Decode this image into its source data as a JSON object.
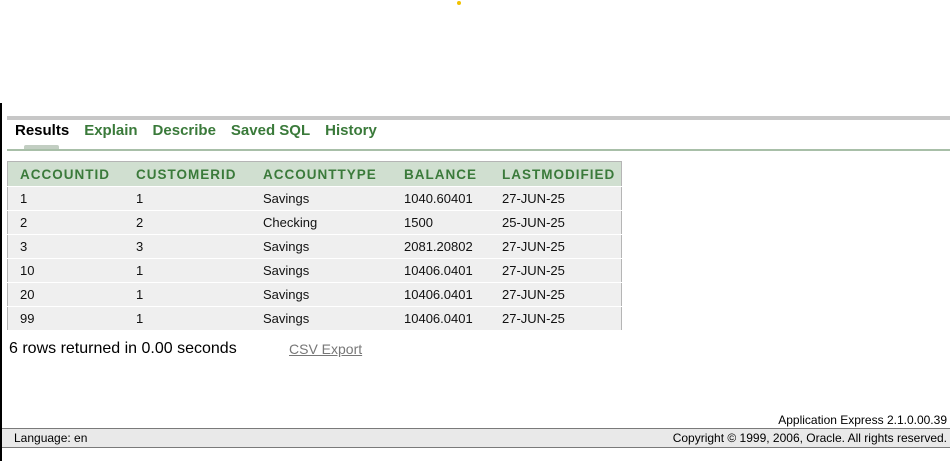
{
  "tabs": [
    {
      "label": "Results",
      "active": true
    },
    {
      "label": "Explain",
      "active": false
    },
    {
      "label": "Describe",
      "active": false
    },
    {
      "label": "Saved SQL",
      "active": false
    },
    {
      "label": "History",
      "active": false
    }
  ],
  "results": {
    "columns": [
      "ACCOUNTID",
      "CUSTOMERID",
      "ACCOUNTTYPE",
      "BALANCE",
      "LASTMODIFIED"
    ],
    "rows": [
      [
        "1",
        "1",
        "Savings",
        "1040.60401",
        "27-JUN-25"
      ],
      [
        "2",
        "2",
        "Checking",
        "1500",
        "25-JUN-25"
      ],
      [
        "3",
        "3",
        "Savings",
        "2081.20802",
        "27-JUN-25"
      ],
      [
        "10",
        "1",
        "Savings",
        "10406.0401",
        "27-JUN-25"
      ],
      [
        "20",
        "1",
        "Savings",
        "10406.0401",
        "27-JUN-25"
      ],
      [
        "99",
        "1",
        "Savings",
        "10406.0401",
        "27-JUN-25"
      ]
    ],
    "row_count_text": "6 rows returned in 0.00 seconds",
    "csv_export_label": "CSV Export"
  },
  "footer": {
    "version": "Application Express 2.1.0.00.39",
    "language": "Language: en",
    "copyright": "Copyright © 1999, 2006, Oracle. All rights reserved."
  },
  "colors": {
    "accent_green": "#3a7a3a",
    "header_bg": "#d0dfd0",
    "row_bg": "#efefef"
  }
}
